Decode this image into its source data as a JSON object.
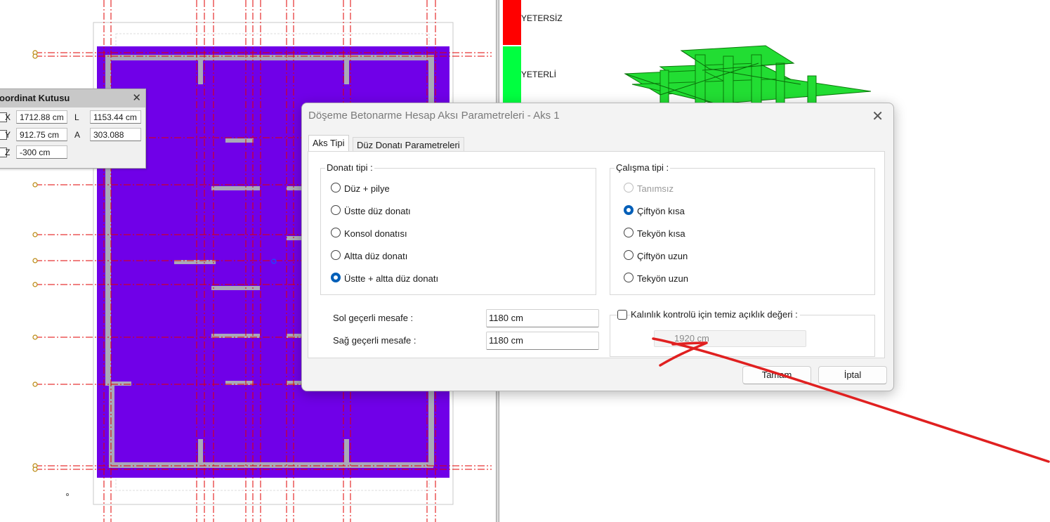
{
  "legend": {
    "insufficient": "YETERSİZ",
    "sufficient": "YETERLİ",
    "insufficient_color": "#ff0000",
    "sufficient_color": "#00ff40"
  },
  "coord_box": {
    "title": "oordinat Kutusu",
    "x_label": "X",
    "x_value": "1712.88 cm",
    "y_label": "Y",
    "y_value": "912.75 cm",
    "z_label": "Z",
    "z_value": "-300 cm",
    "l_label": "L",
    "l_value": "1153.44 cm",
    "a_label": "A",
    "a_value": "303.088"
  },
  "dialog": {
    "title": "Döşeme Betonarme Hesap Aksı Parametreleri - Aks 1",
    "tabs": [
      {
        "label": "Aks Tipi",
        "active": true
      },
      {
        "label": "Düz Donatı Parametreleri",
        "active": false
      }
    ],
    "reinforcement_type": {
      "legend": "Donatı tipi :",
      "options": [
        {
          "label": "Düz + pilye",
          "checked": false
        },
        {
          "label": "Üstte düz donatı",
          "checked": false
        },
        {
          "label": "Konsol donatısı",
          "checked": false
        },
        {
          "label": "Altta düz donatı",
          "checked": false
        },
        {
          "label": "Üstte + altta düz donatı",
          "checked": true
        }
      ]
    },
    "work_type": {
      "legend": "Çalışma tipi :",
      "options": [
        {
          "label": "Tanımsız",
          "checked": false,
          "disabled": true
        },
        {
          "label": "Çiftyön kısa",
          "checked": true
        },
        {
          "label": "Tekyön kısa",
          "checked": false
        },
        {
          "label": "Çiftyön uzun",
          "checked": false
        },
        {
          "label": "Tekyön uzun",
          "checked": false
        }
      ]
    },
    "left_distance": {
      "label": "Sol geçerli mesafe :",
      "value": "1180 cm"
    },
    "right_distance": {
      "label": "Sağ geçerli mesafe :",
      "value": "1180 cm"
    },
    "thickness_check": {
      "label": "Kalınlık kontrolü için temiz açıklık değeri :",
      "checked": false,
      "value": "1920 cm"
    },
    "ok_label": "Tamam",
    "cancel_label": "İptal"
  },
  "colors": {
    "slab": "#7000e8",
    "beam": "#a9a9b8",
    "axis": "#e00000",
    "accent": "#005fb8",
    "annotation": "#e02020"
  }
}
